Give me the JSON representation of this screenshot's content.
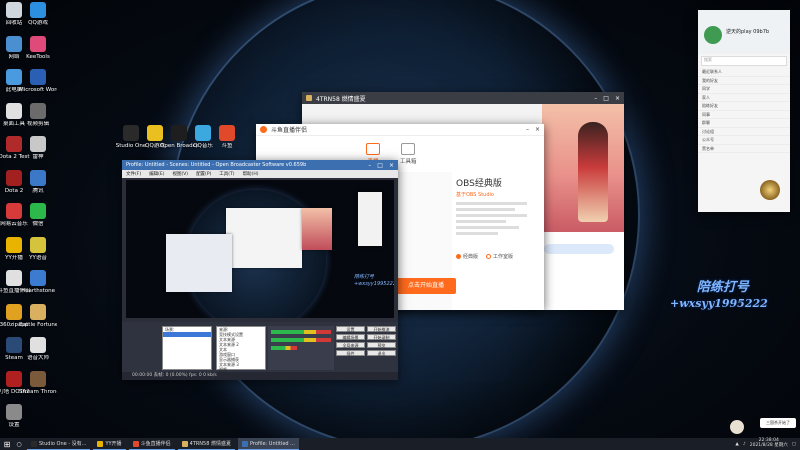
{
  "desktop_icons": [
    {
      "label": "回收站",
      "color": "#d0d6de"
    },
    {
      "label": "QQ游戏",
      "color": "#2d8fe0"
    },
    {
      "label": "网络",
      "color": "#4a8fd0"
    },
    {
      "label": "KeeTools",
      "color": "#e04a7a"
    },
    {
      "label": "此电脑",
      "color": "#4a9ae0"
    },
    {
      "label": "Microsoft Word 2010",
      "color": "#2b5fb4"
    },
    {
      "label": "桌面工具",
      "color": "#e0e0e0"
    },
    {
      "label": "视频剪辑",
      "color": "#6b6b6b"
    },
    {
      "label": "Dota 2 Test",
      "color": "#b02a2a"
    },
    {
      "label": "雷神",
      "color": "#c8c8c8"
    },
    {
      "label": "Dota 2",
      "color": "#a32020"
    },
    {
      "label": "腾讯",
      "color": "#3b78c8"
    },
    {
      "label": "网易云音乐",
      "color": "#d63a3a"
    },
    {
      "label": "微信",
      "color": "#2db84b"
    },
    {
      "label": "YY开播",
      "color": "#e9b400"
    },
    {
      "label": "YY语音",
      "color": "#d4c33b"
    },
    {
      "label": "斗鱼直播伴侣",
      "color": "#e0e0e0"
    },
    {
      "label": "Hearthstone",
      "color": "#3b7bd0"
    },
    {
      "label": "360zipapp",
      "color": "#e0a020"
    },
    {
      "label": "Battle Fortune",
      "color": "#d8b060"
    },
    {
      "label": "Steam",
      "color": "#2a4a78"
    },
    {
      "label": "语音大师",
      "color": "#e0e0e0"
    },
    {
      "label": "刀塔 DOTA2",
      "color": "#b02020"
    },
    {
      "label": "Stream Throne",
      "color": "#7a5a3a"
    },
    {
      "label": "设置",
      "color": "#8a8a8a"
    }
  ],
  "top_icons": [
    {
      "label": "Studio One",
      "color": "#2a2a2a"
    },
    {
      "label": "QQ游戏",
      "color": "#e9c020"
    },
    {
      "label": "Open Broadcast",
      "color": "#1e1e1e"
    },
    {
      "label": "QQ音乐",
      "color": "#3ba8e0"
    },
    {
      "label": "斗鱼",
      "color": "#e04a2a"
    }
  ],
  "game_window": {
    "title": "4TRN58 燃情盛夏"
  },
  "stream_window": {
    "title": "斗鱼直播伴侣",
    "tabs": [
      "直播",
      "工具箱"
    ],
    "obs_title": "OBS经典版",
    "obs_sub": "基于OBS Studio",
    "radio_a": "经典版",
    "radio_b": "工作室版",
    "start_label": "点击开始直播"
  },
  "obs_window": {
    "title": "Profile: Untitled - Scenes: Untitled - Open Broadcaster Software v0.659b",
    "menu": [
      "文件(F)",
      "编辑(E)",
      "视图(V)",
      "配置(P)",
      "工具(T)",
      "帮助(H)"
    ],
    "scenes_header": "场景:",
    "sources_header": "来源:",
    "sources": [
      "竞技模式设置",
      "文本来源",
      "文本来源 2",
      "文本",
      "游戏窗口",
      "显示器捕获",
      "文本来源 3",
      "视频"
    ],
    "buttons": [
      "设置",
      "开始推流",
      "编辑场景",
      "开始录制",
      "全局来源",
      "预览",
      "插件",
      "退出"
    ],
    "status": "00:00:00 丢帧: 0 (0.00%) fps: 0 0 kb/s",
    "overlay": "陪练打号 +wxsyy1995222"
  },
  "qq_panel": {
    "name": "逆天的play 09b7b",
    "search": "搜索",
    "items": [
      "最近联系人",
      "我的好友",
      "同学",
      "家人",
      "陪练好友",
      "同事",
      "群聊",
      "讨论组",
      "公众号",
      "黑名单"
    ]
  },
  "overlay": {
    "line1": "陪练打号",
    "line2": "+wxsyy1995222"
  },
  "notification": {
    "text": "三国杀开始了"
  },
  "taskbar": {
    "items": [
      {
        "label": "Studio One - 没有...",
        "color": "#2a2a2a"
      },
      {
        "label": "YY开播",
        "color": "#e9b400"
      },
      {
        "label": "斗鱼直播伴侣",
        "color": "#e04a2a"
      },
      {
        "label": "4TRN58 燃情盛夏",
        "color": "#d8b060"
      },
      {
        "label": "Profile: Untitled ...",
        "color": "#3a6fb0"
      }
    ],
    "time": "22:38:04",
    "date": "2021/8/28 星期六"
  }
}
